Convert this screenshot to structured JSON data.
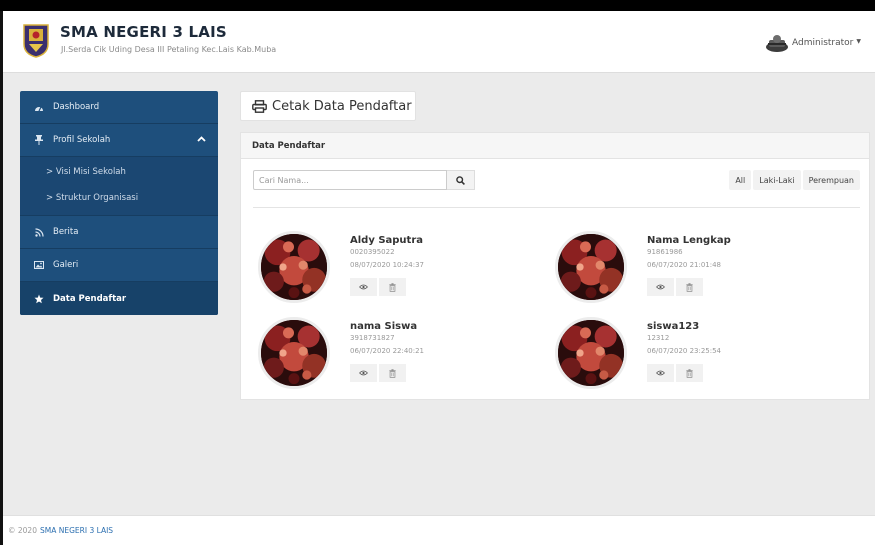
{
  "header": {
    "school_name": "SMA NEGERI 3 LAIS",
    "address": "Jl.Serda Cik Uding Desa III Petaling Kec.Lais Kab.Muba",
    "user_name": "Administrator",
    "logo_icon": "school-crest-icon",
    "user_icon": "user-avatar-icon"
  },
  "sidebar": {
    "items": [
      {
        "label": "Dashboard",
        "icon": "dashboard-icon"
      },
      {
        "label": "Profil Sekolah",
        "icon": "pin-icon"
      },
      {
        "label": "> Visi Misi Sekolah"
      },
      {
        "label": "> Struktur Organisasi"
      },
      {
        "label": "Berita",
        "icon": "rss-icon"
      },
      {
        "label": "Galeri",
        "icon": "image-icon"
      },
      {
        "label": "Data Pendaftar",
        "icon": "star-icon"
      }
    ]
  },
  "print_button": {
    "label": "Cetak Data Pendaftar",
    "icon": "print-icon"
  },
  "panel": {
    "title": "Data Pendaftar",
    "search_placeholder": "Cari Nama...",
    "filters": [
      "All",
      "Laki-Laki",
      "Perempuan"
    ]
  },
  "registrants": [
    {
      "name": "Aldy Saputra",
      "nisn": "0020395022",
      "date": "08/07/2020 10:24:37"
    },
    {
      "name": "Nama Lengkap",
      "nisn": "91861986",
      "date": "06/07/2020 21:01:48"
    },
    {
      "name": "nama Siswa",
      "nisn": "3918731827",
      "date": "06/07/2020 22:40:21"
    },
    {
      "name": "siswa123",
      "nisn": "12312",
      "date": "06/07/2020 23:25:54"
    }
  ],
  "footer": {
    "copyright": "© 2020",
    "link": "SMA NEGERI 3 LAIS"
  },
  "colors": {
    "sidebar": "#1e4f7c",
    "sidebar_active": "#174269",
    "link": "#2c6fb0"
  }
}
